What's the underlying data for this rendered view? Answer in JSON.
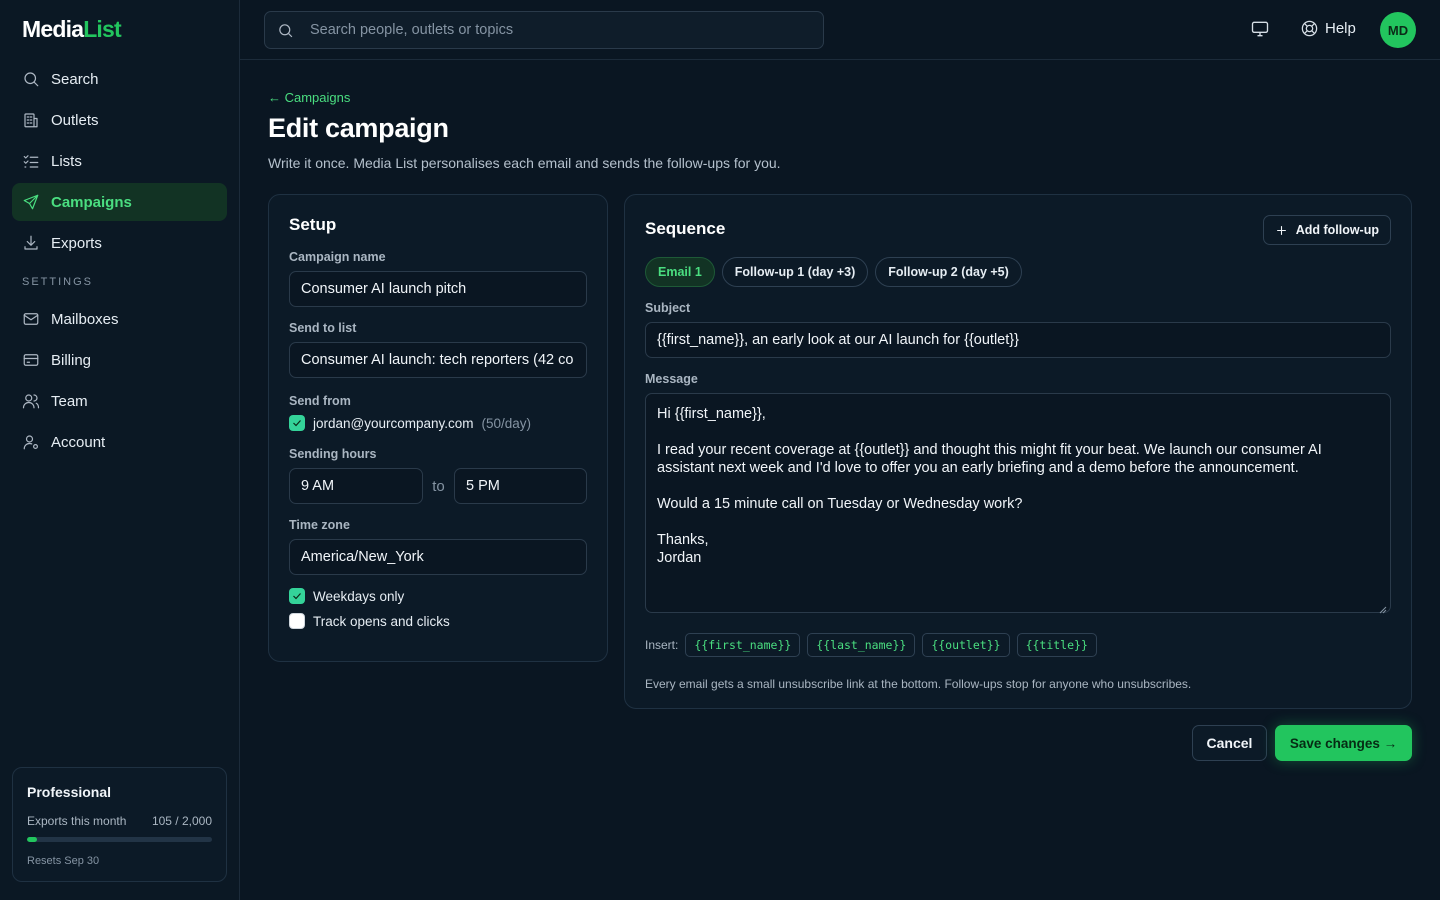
{
  "brand": {
    "logo_main": "Media",
    "logo_accent": "List"
  },
  "sidebar": {
    "items": [
      {
        "label": "Search",
        "icon": "search-icon"
      },
      {
        "label": "Outlets",
        "icon": "building-icon"
      },
      {
        "label": "Lists",
        "icon": "list-check-icon"
      },
      {
        "label": "Campaigns",
        "icon": "send-icon",
        "active": true
      },
      {
        "label": "Exports",
        "icon": "download-icon"
      }
    ],
    "settings_heading": "SETTINGS",
    "settings_items": [
      {
        "label": "Mailboxes",
        "icon": "mail-icon"
      },
      {
        "label": "Billing",
        "icon": "credit-card-icon"
      },
      {
        "label": "Team",
        "icon": "team-icon"
      },
      {
        "label": "Account",
        "icon": "user-gear-icon"
      }
    ],
    "plan": {
      "name": "Professional",
      "usage_label": "Exports this month",
      "usage_value": "105 / 2,000",
      "usage_fraction": 0.0525,
      "reset_text": "Resets Sep 30"
    }
  },
  "topbar": {
    "search_placeholder": "Search people, outlets or topics",
    "help_label": "Help",
    "avatar_initials": "MD"
  },
  "page": {
    "breadcrumb": "← Campaigns",
    "title": "Edit campaign",
    "subtitle": "Write it once. Media List personalises each email and sends the follow-ups for you."
  },
  "setup": {
    "title": "Setup",
    "campaign_name_label": "Campaign name",
    "campaign_name": "Consumer AI launch pitch",
    "send_to_label": "Send to list",
    "send_to": "Consumer AI launch: tech reporters (42 co",
    "send_from_label": "Send from",
    "send_from_email": "jordan@yourcompany.com",
    "send_from_limit": "(50/day)",
    "hours_label": "Sending hours",
    "hours_from": "9 AM",
    "hours_to_word": "to",
    "hours_to": "5 PM",
    "timezone_label": "Time zone",
    "timezone": "America/New_York",
    "weekdays_label": "Weekdays only",
    "track_label": "Track opens and clicks"
  },
  "sequence": {
    "title": "Sequence",
    "add_button": "Add follow-up",
    "tabs": [
      "Email 1",
      "Follow-up 1 (day +3)",
      "Follow-up 2 (day +5)"
    ],
    "subject_label": "Subject",
    "subject": "{{first_name}}, an early look at our AI launch for {{outlet}}",
    "message_label": "Message",
    "message_lines": [
      "Hi {{first_name}},",
      "",
      "I read your recent coverage at {{outlet}} and thought this might fit your beat. We launch our consumer AI",
      "assistant next week and I'd love to offer you an early briefing and a demo before the announcement.",
      "",
      "Would a 15 minute call on Tuesday or Wednesday work?",
      "",
      "Thanks,",
      "Jordan"
    ],
    "insert_label": "Insert:",
    "insert_tokens": [
      "{{first_name}}",
      "{{last_name}}",
      "{{outlet}}",
      "{{title}}"
    ],
    "footnote": "Every email gets a small unsubscribe link at the bottom. Follow-ups stop for anyone who unsubscribes."
  },
  "actions": {
    "cancel": "Cancel",
    "save": "Save changes →"
  },
  "colors": {
    "background": "#0a1622",
    "accent": "#22c55e",
    "accent_text": "#4ade80"
  }
}
